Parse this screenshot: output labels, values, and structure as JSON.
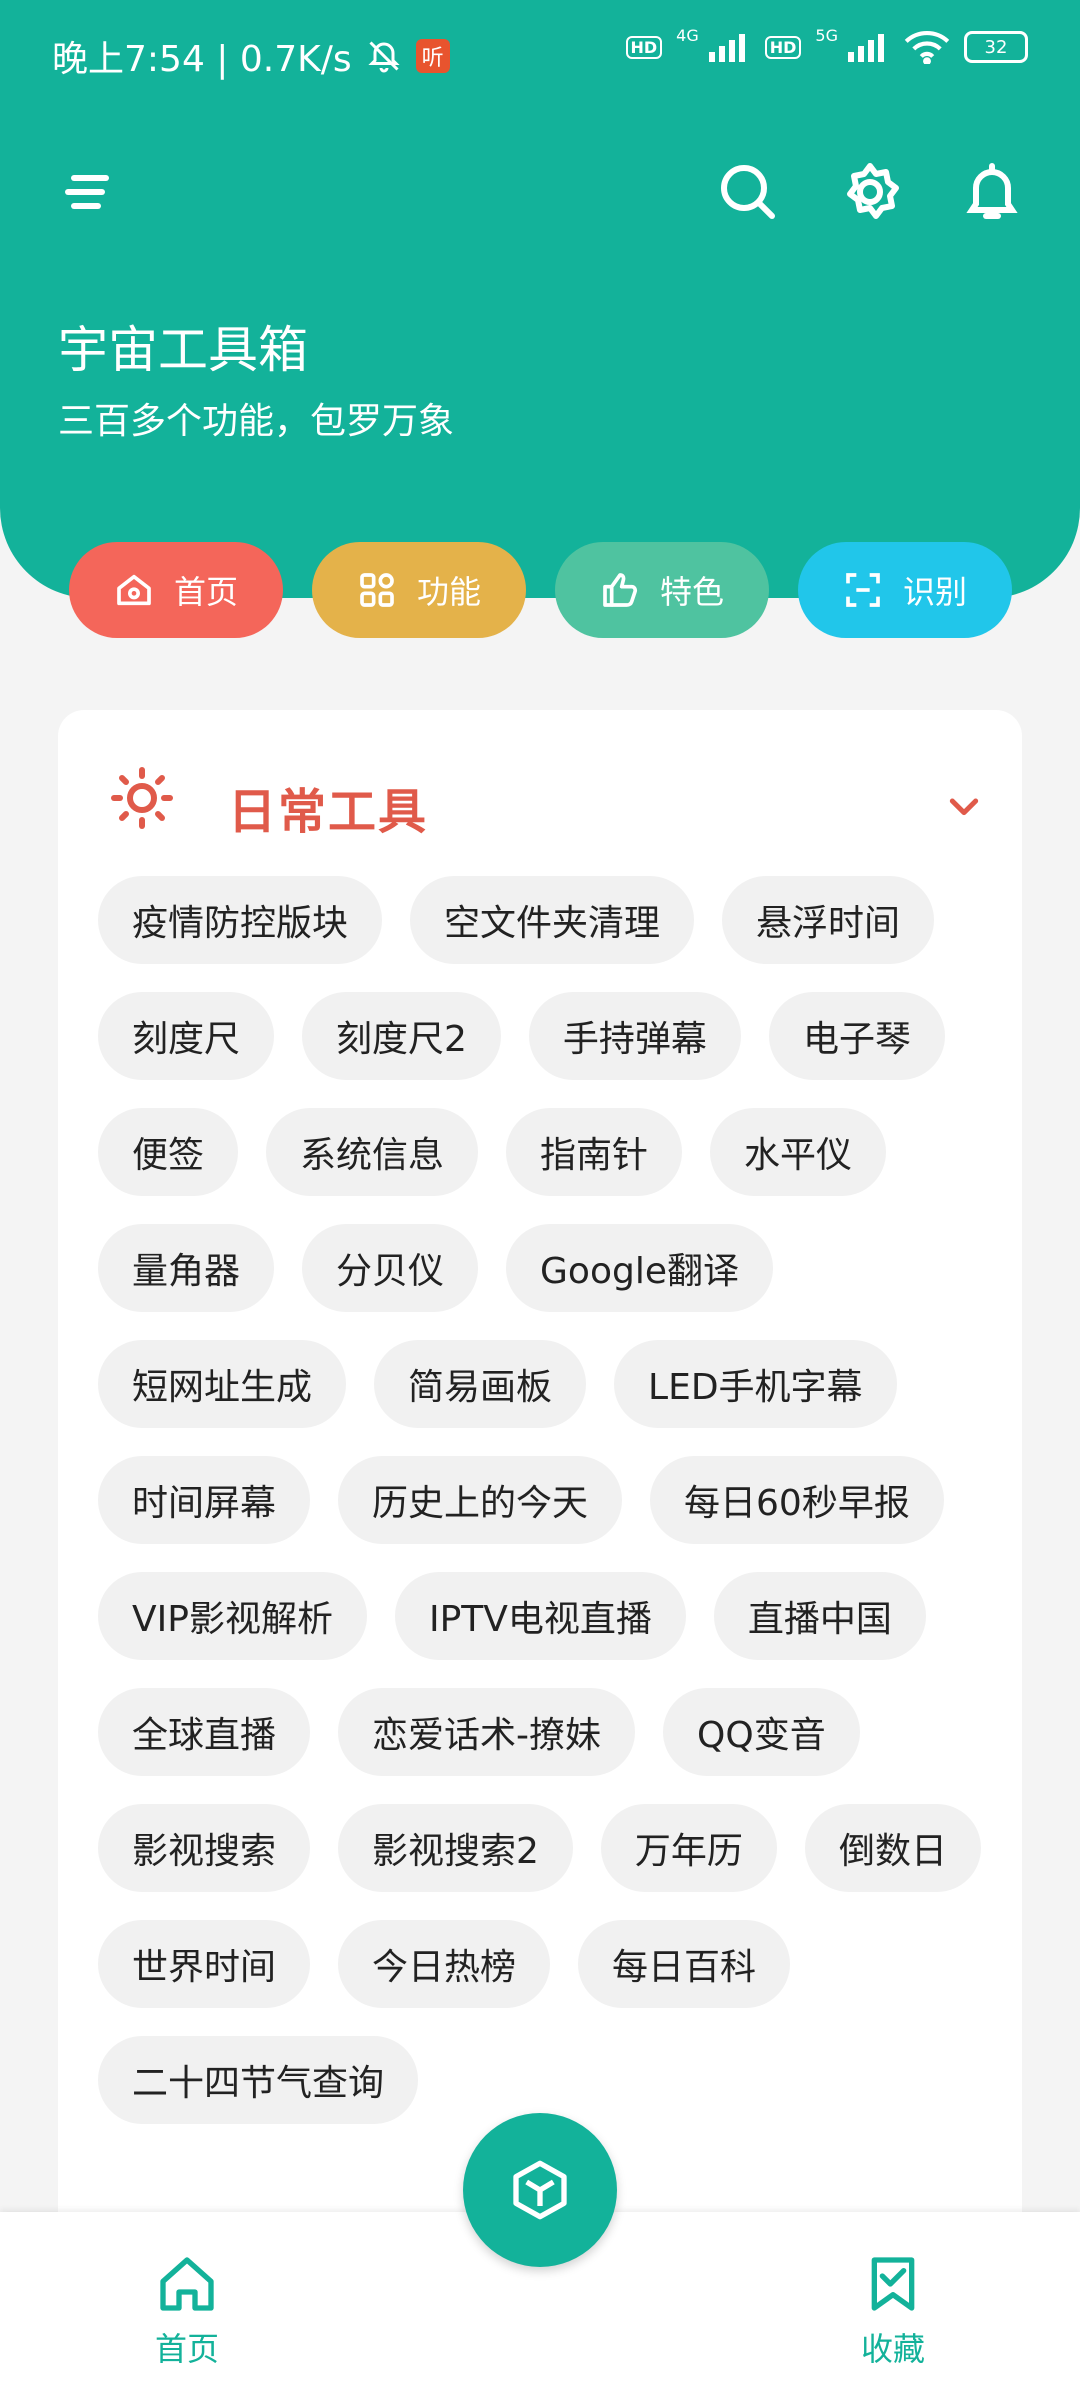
{
  "status": {
    "time": "晚上7:54 | 0.7K/s",
    "listen_badge": "听",
    "hd1": "HD",
    "net1": "4G",
    "hd2": "HD",
    "net2": "5G",
    "battery": "32"
  },
  "header": {
    "title": "宇宙工具箱",
    "subtitle": "三百多个功能，包罗万象"
  },
  "quick_nav": [
    {
      "label": "首页",
      "color": "#f4665a"
    },
    {
      "label": "功能",
      "color": "#e4b24a"
    },
    {
      "label": "特色",
      "color": "#4fc3a0"
    },
    {
      "label": "识别",
      "color": "#21c6ea"
    }
  ],
  "card": {
    "title": "日常工具",
    "tags": [
      "疫情防控版块",
      "空文件夹清理",
      "悬浮时间",
      "刻度尺",
      "刻度尺2",
      "手持弹幕",
      "电子琴",
      "便签",
      "系统信息",
      "指南针",
      "水平仪",
      "量角器",
      "分贝仪",
      "Google翻译",
      "短网址生成",
      "简易画板",
      "LED手机字幕",
      "时间屏幕",
      "历史上的今天",
      "每日60秒早报",
      "VIP影视解析",
      "IPTV电视直播",
      "直播中国",
      "全球直播",
      "恋爱话术-撩妹",
      "QQ变音",
      "影视搜索",
      "影视搜索2",
      "万年历",
      "倒数日",
      "世界时间",
      "今日热榜",
      "每日百科",
      "二十四节气查询"
    ]
  },
  "bottom_nav": {
    "home": "首页",
    "favorites": "收藏"
  },
  "colors": {
    "primary": "#13b29a",
    "accent_red": "#e05a4a"
  }
}
